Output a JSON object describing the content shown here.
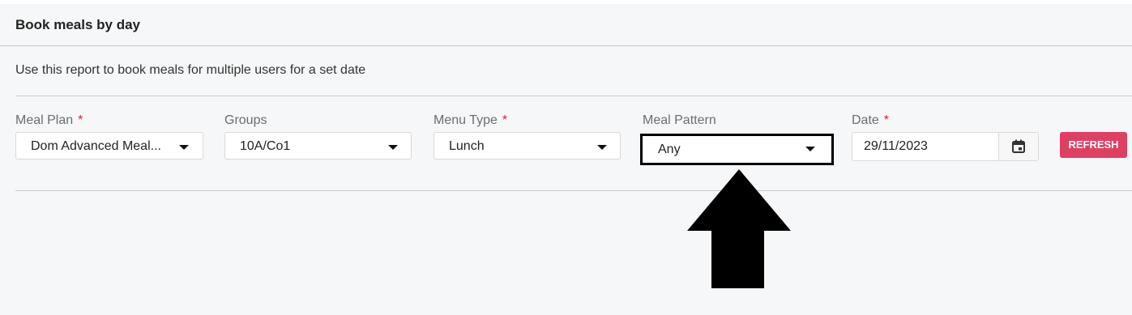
{
  "panel": {
    "title": "Book meals by day",
    "description": "Use this report to book meals for multiple users for a set date"
  },
  "filters": {
    "meal_plan": {
      "label": "Meal Plan",
      "required_mark": "*",
      "value": "Dom Advanced Meal..."
    },
    "groups": {
      "label": "Groups",
      "value": "10A/Co1"
    },
    "menu_type": {
      "label": "Menu Type",
      "required_mark": "*",
      "value": "Lunch"
    },
    "meal_pattern": {
      "label": "Meal Pattern",
      "value": "Any"
    },
    "date": {
      "label": "Date",
      "required_mark": "*",
      "value": "29/11/2023"
    }
  },
  "actions": {
    "refresh_label": "REFRESH"
  },
  "icons": {
    "calendar": "calendar-icon",
    "dropdown": "caret-down-icon",
    "annotation": "up-arrow-icon"
  },
  "colors": {
    "accent": "#e03f64",
    "required": "#d81e35",
    "panel_bg": "#f6f7f8"
  }
}
